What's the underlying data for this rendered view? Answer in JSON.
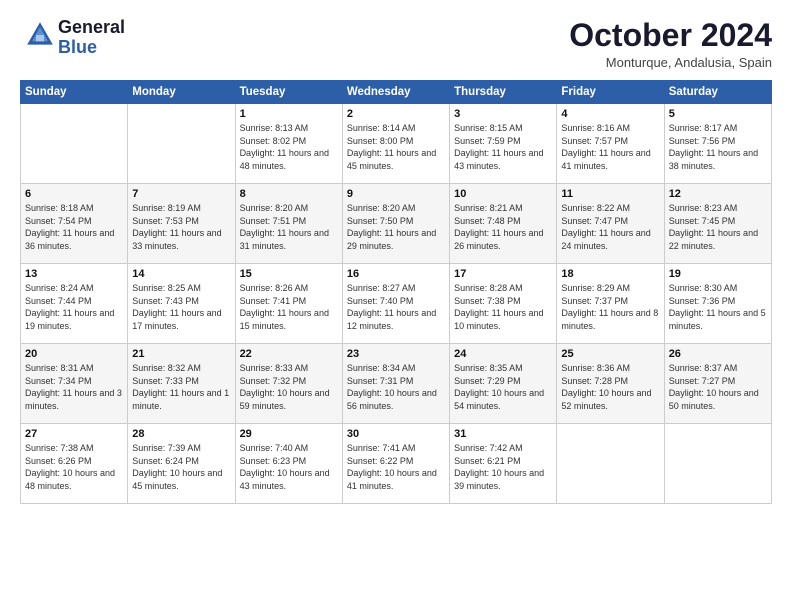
{
  "header": {
    "logo_general": "General",
    "logo_blue": "Blue",
    "month_title": "October 2024",
    "location": "Monturque, Andalusia, Spain"
  },
  "days_of_week": [
    "Sunday",
    "Monday",
    "Tuesday",
    "Wednesday",
    "Thursday",
    "Friday",
    "Saturday"
  ],
  "weeks": [
    [
      {
        "num": "",
        "info": ""
      },
      {
        "num": "",
        "info": ""
      },
      {
        "num": "1",
        "info": "Sunrise: 8:13 AM\nSunset: 8:02 PM\nDaylight: 11 hours and 48 minutes."
      },
      {
        "num": "2",
        "info": "Sunrise: 8:14 AM\nSunset: 8:00 PM\nDaylight: 11 hours and 45 minutes."
      },
      {
        "num": "3",
        "info": "Sunrise: 8:15 AM\nSunset: 7:59 PM\nDaylight: 11 hours and 43 minutes."
      },
      {
        "num": "4",
        "info": "Sunrise: 8:16 AM\nSunset: 7:57 PM\nDaylight: 11 hours and 41 minutes."
      },
      {
        "num": "5",
        "info": "Sunrise: 8:17 AM\nSunset: 7:56 PM\nDaylight: 11 hours and 38 minutes."
      }
    ],
    [
      {
        "num": "6",
        "info": "Sunrise: 8:18 AM\nSunset: 7:54 PM\nDaylight: 11 hours and 36 minutes."
      },
      {
        "num": "7",
        "info": "Sunrise: 8:19 AM\nSunset: 7:53 PM\nDaylight: 11 hours and 33 minutes."
      },
      {
        "num": "8",
        "info": "Sunrise: 8:20 AM\nSunset: 7:51 PM\nDaylight: 11 hours and 31 minutes."
      },
      {
        "num": "9",
        "info": "Sunrise: 8:20 AM\nSunset: 7:50 PM\nDaylight: 11 hours and 29 minutes."
      },
      {
        "num": "10",
        "info": "Sunrise: 8:21 AM\nSunset: 7:48 PM\nDaylight: 11 hours and 26 minutes."
      },
      {
        "num": "11",
        "info": "Sunrise: 8:22 AM\nSunset: 7:47 PM\nDaylight: 11 hours and 24 minutes."
      },
      {
        "num": "12",
        "info": "Sunrise: 8:23 AM\nSunset: 7:45 PM\nDaylight: 11 hours and 22 minutes."
      }
    ],
    [
      {
        "num": "13",
        "info": "Sunrise: 8:24 AM\nSunset: 7:44 PM\nDaylight: 11 hours and 19 minutes."
      },
      {
        "num": "14",
        "info": "Sunrise: 8:25 AM\nSunset: 7:43 PM\nDaylight: 11 hours and 17 minutes."
      },
      {
        "num": "15",
        "info": "Sunrise: 8:26 AM\nSunset: 7:41 PM\nDaylight: 11 hours and 15 minutes."
      },
      {
        "num": "16",
        "info": "Sunrise: 8:27 AM\nSunset: 7:40 PM\nDaylight: 11 hours and 12 minutes."
      },
      {
        "num": "17",
        "info": "Sunrise: 8:28 AM\nSunset: 7:38 PM\nDaylight: 11 hours and 10 minutes."
      },
      {
        "num": "18",
        "info": "Sunrise: 8:29 AM\nSunset: 7:37 PM\nDaylight: 11 hours and 8 minutes."
      },
      {
        "num": "19",
        "info": "Sunrise: 8:30 AM\nSunset: 7:36 PM\nDaylight: 11 hours and 5 minutes."
      }
    ],
    [
      {
        "num": "20",
        "info": "Sunrise: 8:31 AM\nSunset: 7:34 PM\nDaylight: 11 hours and 3 minutes."
      },
      {
        "num": "21",
        "info": "Sunrise: 8:32 AM\nSunset: 7:33 PM\nDaylight: 11 hours and 1 minute."
      },
      {
        "num": "22",
        "info": "Sunrise: 8:33 AM\nSunset: 7:32 PM\nDaylight: 10 hours and 59 minutes."
      },
      {
        "num": "23",
        "info": "Sunrise: 8:34 AM\nSunset: 7:31 PM\nDaylight: 10 hours and 56 minutes."
      },
      {
        "num": "24",
        "info": "Sunrise: 8:35 AM\nSunset: 7:29 PM\nDaylight: 10 hours and 54 minutes."
      },
      {
        "num": "25",
        "info": "Sunrise: 8:36 AM\nSunset: 7:28 PM\nDaylight: 10 hours and 52 minutes."
      },
      {
        "num": "26",
        "info": "Sunrise: 8:37 AM\nSunset: 7:27 PM\nDaylight: 10 hours and 50 minutes."
      }
    ],
    [
      {
        "num": "27",
        "info": "Sunrise: 7:38 AM\nSunset: 6:26 PM\nDaylight: 10 hours and 48 minutes."
      },
      {
        "num": "28",
        "info": "Sunrise: 7:39 AM\nSunset: 6:24 PM\nDaylight: 10 hours and 45 minutes."
      },
      {
        "num": "29",
        "info": "Sunrise: 7:40 AM\nSunset: 6:23 PM\nDaylight: 10 hours and 43 minutes."
      },
      {
        "num": "30",
        "info": "Sunrise: 7:41 AM\nSunset: 6:22 PM\nDaylight: 10 hours and 41 minutes."
      },
      {
        "num": "31",
        "info": "Sunrise: 7:42 AM\nSunset: 6:21 PM\nDaylight: 10 hours and 39 minutes."
      },
      {
        "num": "",
        "info": ""
      },
      {
        "num": "",
        "info": ""
      }
    ]
  ]
}
